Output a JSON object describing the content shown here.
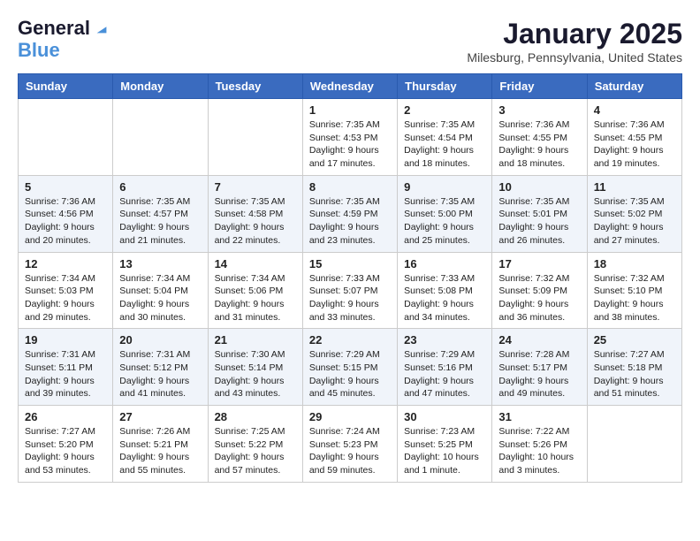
{
  "header": {
    "logo_line1": "General",
    "logo_line2": "Blue",
    "month": "January 2025",
    "location": "Milesburg, Pennsylvania, United States"
  },
  "weekdays": [
    "Sunday",
    "Monday",
    "Tuesday",
    "Wednesday",
    "Thursday",
    "Friday",
    "Saturday"
  ],
  "weeks": [
    [
      {
        "day": "",
        "info": ""
      },
      {
        "day": "",
        "info": ""
      },
      {
        "day": "",
        "info": ""
      },
      {
        "day": "1",
        "info": "Sunrise: 7:35 AM\nSunset: 4:53 PM\nDaylight: 9 hours\nand 17 minutes."
      },
      {
        "day": "2",
        "info": "Sunrise: 7:35 AM\nSunset: 4:54 PM\nDaylight: 9 hours\nand 18 minutes."
      },
      {
        "day": "3",
        "info": "Sunrise: 7:36 AM\nSunset: 4:55 PM\nDaylight: 9 hours\nand 18 minutes."
      },
      {
        "day": "4",
        "info": "Sunrise: 7:36 AM\nSunset: 4:55 PM\nDaylight: 9 hours\nand 19 minutes."
      }
    ],
    [
      {
        "day": "5",
        "info": "Sunrise: 7:36 AM\nSunset: 4:56 PM\nDaylight: 9 hours\nand 20 minutes."
      },
      {
        "day": "6",
        "info": "Sunrise: 7:35 AM\nSunset: 4:57 PM\nDaylight: 9 hours\nand 21 minutes."
      },
      {
        "day": "7",
        "info": "Sunrise: 7:35 AM\nSunset: 4:58 PM\nDaylight: 9 hours\nand 22 minutes."
      },
      {
        "day": "8",
        "info": "Sunrise: 7:35 AM\nSunset: 4:59 PM\nDaylight: 9 hours\nand 23 minutes."
      },
      {
        "day": "9",
        "info": "Sunrise: 7:35 AM\nSunset: 5:00 PM\nDaylight: 9 hours\nand 25 minutes."
      },
      {
        "day": "10",
        "info": "Sunrise: 7:35 AM\nSunset: 5:01 PM\nDaylight: 9 hours\nand 26 minutes."
      },
      {
        "day": "11",
        "info": "Sunrise: 7:35 AM\nSunset: 5:02 PM\nDaylight: 9 hours\nand 27 minutes."
      }
    ],
    [
      {
        "day": "12",
        "info": "Sunrise: 7:34 AM\nSunset: 5:03 PM\nDaylight: 9 hours\nand 29 minutes."
      },
      {
        "day": "13",
        "info": "Sunrise: 7:34 AM\nSunset: 5:04 PM\nDaylight: 9 hours\nand 30 minutes."
      },
      {
        "day": "14",
        "info": "Sunrise: 7:34 AM\nSunset: 5:06 PM\nDaylight: 9 hours\nand 31 minutes."
      },
      {
        "day": "15",
        "info": "Sunrise: 7:33 AM\nSunset: 5:07 PM\nDaylight: 9 hours\nand 33 minutes."
      },
      {
        "day": "16",
        "info": "Sunrise: 7:33 AM\nSunset: 5:08 PM\nDaylight: 9 hours\nand 34 minutes."
      },
      {
        "day": "17",
        "info": "Sunrise: 7:32 AM\nSunset: 5:09 PM\nDaylight: 9 hours\nand 36 minutes."
      },
      {
        "day": "18",
        "info": "Sunrise: 7:32 AM\nSunset: 5:10 PM\nDaylight: 9 hours\nand 38 minutes."
      }
    ],
    [
      {
        "day": "19",
        "info": "Sunrise: 7:31 AM\nSunset: 5:11 PM\nDaylight: 9 hours\nand 39 minutes."
      },
      {
        "day": "20",
        "info": "Sunrise: 7:31 AM\nSunset: 5:12 PM\nDaylight: 9 hours\nand 41 minutes."
      },
      {
        "day": "21",
        "info": "Sunrise: 7:30 AM\nSunset: 5:14 PM\nDaylight: 9 hours\nand 43 minutes."
      },
      {
        "day": "22",
        "info": "Sunrise: 7:29 AM\nSunset: 5:15 PM\nDaylight: 9 hours\nand 45 minutes."
      },
      {
        "day": "23",
        "info": "Sunrise: 7:29 AM\nSunset: 5:16 PM\nDaylight: 9 hours\nand 47 minutes."
      },
      {
        "day": "24",
        "info": "Sunrise: 7:28 AM\nSunset: 5:17 PM\nDaylight: 9 hours\nand 49 minutes."
      },
      {
        "day": "25",
        "info": "Sunrise: 7:27 AM\nSunset: 5:18 PM\nDaylight: 9 hours\nand 51 minutes."
      }
    ],
    [
      {
        "day": "26",
        "info": "Sunrise: 7:27 AM\nSunset: 5:20 PM\nDaylight: 9 hours\nand 53 minutes."
      },
      {
        "day": "27",
        "info": "Sunrise: 7:26 AM\nSunset: 5:21 PM\nDaylight: 9 hours\nand 55 minutes."
      },
      {
        "day": "28",
        "info": "Sunrise: 7:25 AM\nSunset: 5:22 PM\nDaylight: 9 hours\nand 57 minutes."
      },
      {
        "day": "29",
        "info": "Sunrise: 7:24 AM\nSunset: 5:23 PM\nDaylight: 9 hours\nand 59 minutes."
      },
      {
        "day": "30",
        "info": "Sunrise: 7:23 AM\nSunset: 5:25 PM\nDaylight: 10 hours\nand 1 minute."
      },
      {
        "day": "31",
        "info": "Sunrise: 7:22 AM\nSunset: 5:26 PM\nDaylight: 10 hours\nand 3 minutes."
      },
      {
        "day": "",
        "info": ""
      }
    ]
  ]
}
